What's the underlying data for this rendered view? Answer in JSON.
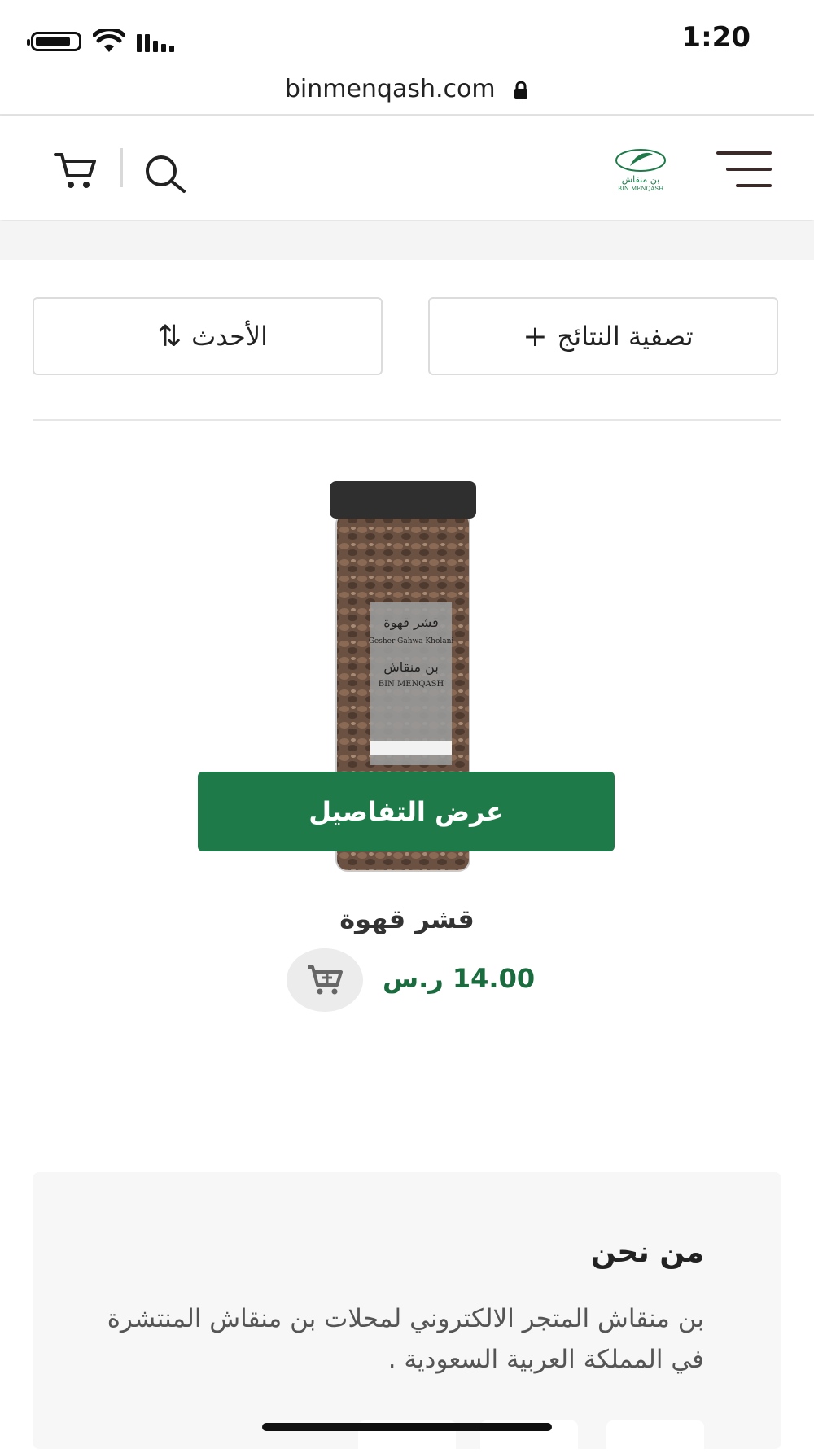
{
  "status_bar": {
    "time": "1:20"
  },
  "browser": {
    "url": "binmenqash.com"
  },
  "header": {
    "logo_text_ar": "بن منقاش",
    "logo_text_en": "BIN MENQASH"
  },
  "toolbar": {
    "filter_label": "تصفية النتائج",
    "sort_label": "الأحدث"
  },
  "product": {
    "image_label_ar": "قشر قهوة",
    "image_label_en": "Gesher Gahwa Kholani",
    "details_button": "عرض التفاصيل",
    "name": "قشر قهوة",
    "price": "14.00 ر.س"
  },
  "about": {
    "title": "من نحن",
    "text": "بن منقاش المتجر الالكتروني لمحلات بن منقاش المنتشرة في المملكة العربية السعودية ."
  },
  "colors": {
    "brand_green": "#1e7a49",
    "price_green": "#1a6b3e"
  }
}
